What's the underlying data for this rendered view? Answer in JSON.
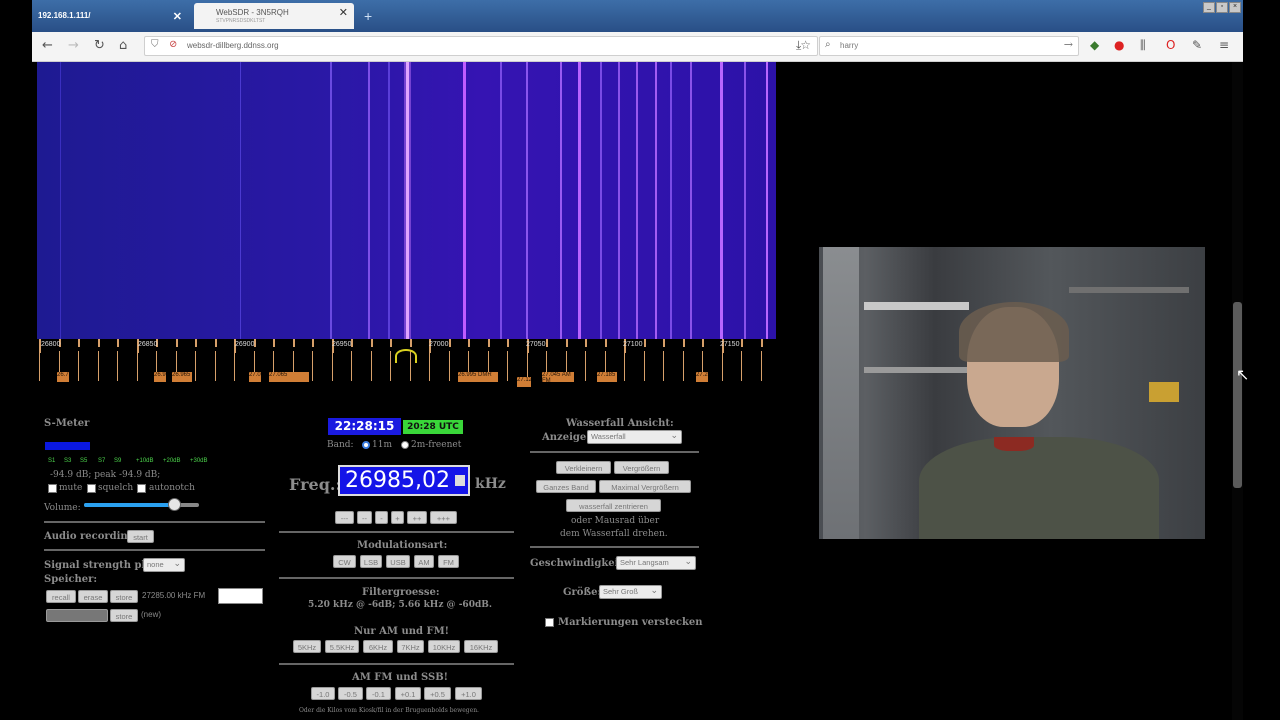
{
  "browser": {
    "tabs": [
      {
        "title": "192.168.1.111/"
      },
      {
        "title": "WebSDR - 3N5RQH",
        "subtitle": "STVPNRSDSDKLTST"
      }
    ],
    "url": "websdr-dillberg.ddnss.org",
    "search": "harry",
    "window_controls": [
      "_",
      "▫",
      "×"
    ]
  },
  "waterfall": {
    "scale_labels": [
      "26800",
      "26850",
      "26900",
      "26950",
      "27000",
      "27050",
      "27100",
      "27150"
    ],
    "station_labels": [
      "26.775",
      "26.965",
      "26.965",
      "27.025",
      "27.065",
      "26.995 DMR",
      "27.125",
      "27.045 AM FM",
      "27.185",
      "27.205"
    ]
  },
  "smeter": {
    "title": "S-Meter",
    "scale": [
      "S1",
      "S3",
      "S5",
      "S7",
      "S9",
      "+10dB",
      "+20dB",
      "+30dB"
    ],
    "reading": "-94.9 dB; peak -94.9 dB;",
    "checkboxes": [
      "mute",
      "squelch",
      "autonotch"
    ],
    "volume_label": "Volume:",
    "volume_level": 0.78,
    "audio_label": "Audio recording:",
    "audio_button": "start",
    "plot_label": "Signal strength plot:",
    "plot_value": "none",
    "memory_label": "Speicher:",
    "memory_buttons": [
      "recall",
      "erase",
      "store"
    ],
    "memory_entry": "27285.00 kHz FM",
    "store2": "store",
    "new_label": "(new)"
  },
  "tuner": {
    "time": "22:28:15",
    "utc": "20:28 UTC",
    "band_label": "Band:",
    "bands": [
      "11m",
      "2m-freenet"
    ],
    "freq_label": "Freq.:",
    "freq_value": "26985,02",
    "freq_unit": "kHz",
    "step_buttons": [
      "---",
      "--",
      "-",
      "+",
      "++",
      "+++"
    ],
    "mod_label": "Modulationsart:",
    "modes": [
      "CW",
      "LSB",
      "USB",
      "AM",
      "FM"
    ],
    "filter_label": "Filtergroesse:",
    "filter_value": "5.20 kHz @ -6dB; 5.66 kHz @ -60dB.",
    "amfm_label": "Nur AM und FM!",
    "amfm_buttons": [
      "5KHz",
      "5.5KHz",
      "6KHz",
      "7KHz",
      "10KHz",
      "16KHz"
    ],
    "ssb_label": "AM FM und SSB!",
    "ssb_buttons": [
      "-1.0",
      "-0.5",
      "-0.1",
      "+0.1",
      "+0.5",
      "+1.0"
    ],
    "hint": "Oder die Kilos vom Kiosk/fil in der Bruguenbolds bewegen."
  },
  "wf_view": {
    "title": "Wasserfall Ansicht:",
    "display_label": "Anzeige:",
    "display_value": "Wasserfall",
    "zoom_buttons": [
      "Verkleinern",
      "Vergrößern",
      "Ganzes Band",
      "Maximal Vergrößern",
      "wasserfall zentrieren"
    ],
    "mouse_hint_1": "oder Mausrad über",
    "mouse_hint_2": "dem Wasserfall drehen.",
    "speed_label": "Geschwindigkeit:",
    "speed_value": "Sehr Langsam",
    "size_label": "Größe:",
    "size_value": "Sehr Groß",
    "hide_markers": "Markierungen verstecken"
  },
  "colors": {
    "freq_box": "#1414e8",
    "clock_bg": "#1a1ae0",
    "utc_bg": "#39d639",
    "label_orange": "#d07e36",
    "waterfall": "#2a18a6"
  }
}
